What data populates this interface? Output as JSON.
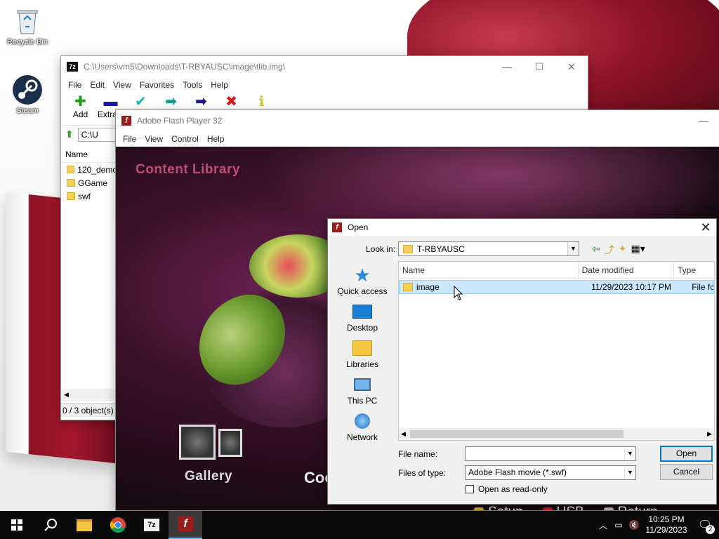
{
  "desktop": {
    "icons": [
      {
        "label": "Recycle Bin",
        "icon": "recycle-bin-icon"
      },
      {
        "label": "Steam",
        "icon": "steam-icon"
      }
    ]
  },
  "zip_window": {
    "title": "C:\\Users\\vm5\\Downloads\\T-RBYAUSC\\image\\tlib.img\\",
    "menu": [
      "File",
      "Edit",
      "View",
      "Favorites",
      "Tools",
      "Help"
    ],
    "toolbar": [
      {
        "label": "Add",
        "icon": "plus-icon",
        "color": "#1aa31a"
      },
      {
        "label": "Extract",
        "icon": "minus-icon",
        "color": "#1a1aa8"
      },
      {
        "label": "",
        "icon": "test-icon",
        "color": "#19b3b3"
      },
      {
        "label": "",
        "icon": "copy-icon",
        "color": "#1a9a8a"
      },
      {
        "label": "",
        "icon": "move-icon",
        "color": "#1a1a8a"
      },
      {
        "label": "",
        "icon": "delete-icon",
        "color": "#d11a1a"
      },
      {
        "label": "",
        "icon": "info-icon",
        "color": "#d9c21a"
      }
    ],
    "address": "C:\\U",
    "list_header": "Name",
    "items": [
      "120_demo",
      "GGame",
      "swf"
    ],
    "status": "0 / 3 object(s)"
  },
  "flash_window": {
    "title": "Adobe Flash Player 32",
    "menu": [
      "File",
      "View",
      "Control",
      "Help"
    ],
    "content_title": "Content Library",
    "gallery_label": "Gallery",
    "cook_label": "Coo",
    "bottom_buttons": [
      {
        "label": "Setup",
        "color": "#e8b52a"
      },
      {
        "label": "USB",
        "color": "#d8202f"
      },
      {
        "label": "Return",
        "color": "#cccccc"
      }
    ]
  },
  "open_dialog": {
    "title": "Open",
    "look_in_label": "Look in:",
    "look_in_value": "T-RBYAUSC",
    "places": [
      {
        "label": "Quick access",
        "icon": "star-icon"
      },
      {
        "label": "Desktop",
        "icon": "desktop-icon"
      },
      {
        "label": "Libraries",
        "icon": "libraries-icon"
      },
      {
        "label": "This PC",
        "icon": "this-pc-icon"
      },
      {
        "label": "Network",
        "icon": "network-icon"
      }
    ],
    "columns": [
      "Name",
      "Date modified",
      "Type"
    ],
    "rows": [
      {
        "name": "image",
        "date": "11/29/2023 10:17 PM",
        "type": "File fo"
      }
    ],
    "file_name_label": "File name:",
    "file_name_value": "",
    "file_type_label": "Files of type:",
    "file_type_value": "Adobe Flash movie (*.swf)",
    "read_only_label": "Open as read-only",
    "open_button": "Open",
    "cancel_button": "Cancel"
  },
  "taskbar": {
    "apps": [
      "start-icon",
      "search-icon",
      "file-explorer-icon",
      "chrome-icon",
      "7zip-icon",
      "flash-icon"
    ],
    "time": "10:25 PM",
    "date": "11/29/2023",
    "notification_count": "2"
  }
}
